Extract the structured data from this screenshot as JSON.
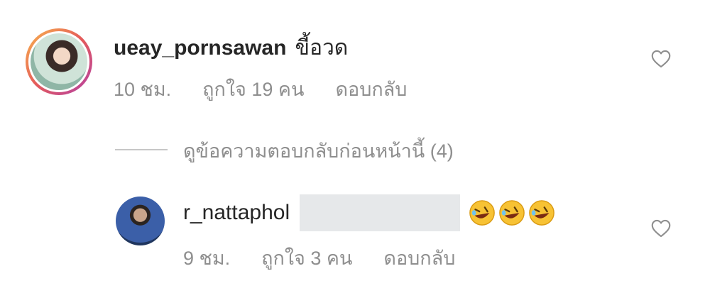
{
  "comment": {
    "username": "ueay_pornsawan",
    "text": "ขี้อวด",
    "time": "10 ชม.",
    "likes": "ถูกใจ 19 คน",
    "reply_label": "ดอบกลับ",
    "avatar_icon": "profile-photo"
  },
  "view_previous_replies": "ดูข้อความตอบกลับก่อนหน้านี้ (4)",
  "reply": {
    "username": "r_nattaphol",
    "emojis": [
      "rolling-on-floor-laughing",
      "rolling-on-floor-laughing",
      "rolling-on-floor-laughing"
    ],
    "time": "9 ชม.",
    "likes": "ถูกใจ 3 คน",
    "reply_label": "ดอบกลับ",
    "avatar_icon": "profile-photo"
  },
  "icons": {
    "like": "heart-outline-icon"
  },
  "colors": {
    "text": "#262626",
    "secondary": "#8e8e8e",
    "redaction": "#e6e8ea"
  }
}
